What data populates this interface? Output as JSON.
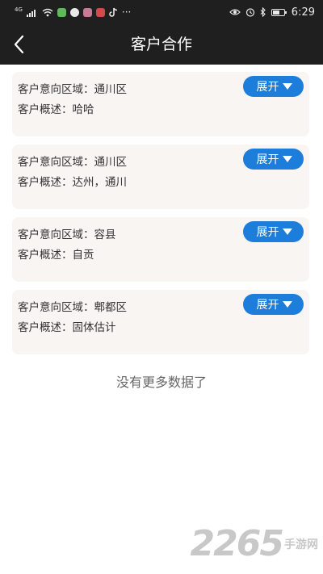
{
  "status_bar": {
    "network_label": "4G",
    "time": "6:29",
    "more_label": "···",
    "battery_level": 0.6
  },
  "header": {
    "title": "客户合作"
  },
  "list": {
    "items": [
      {
        "area": "客户意向区域：通川区",
        "desc": "客户概述：哈哈",
        "button": "展开"
      },
      {
        "area": "客户意向区域：通川区",
        "desc": "客户概述：达州，通川",
        "button": "展开"
      },
      {
        "area": "客户意向区域：容县",
        "desc": "客户概述：自贡",
        "button": "展开"
      },
      {
        "area": "客户意向区域：郫都区",
        "desc": "客户概述：固体估计",
        "button": "展开"
      }
    ],
    "footer_text": "没有更多数据了"
  },
  "watermark": {
    "brand": "2265",
    "sub": "手游网"
  },
  "colors": {
    "header_bg": "#1f1f1f",
    "card_bg": "#f8f5f3",
    "button_bg": "#1d7ddb"
  }
}
